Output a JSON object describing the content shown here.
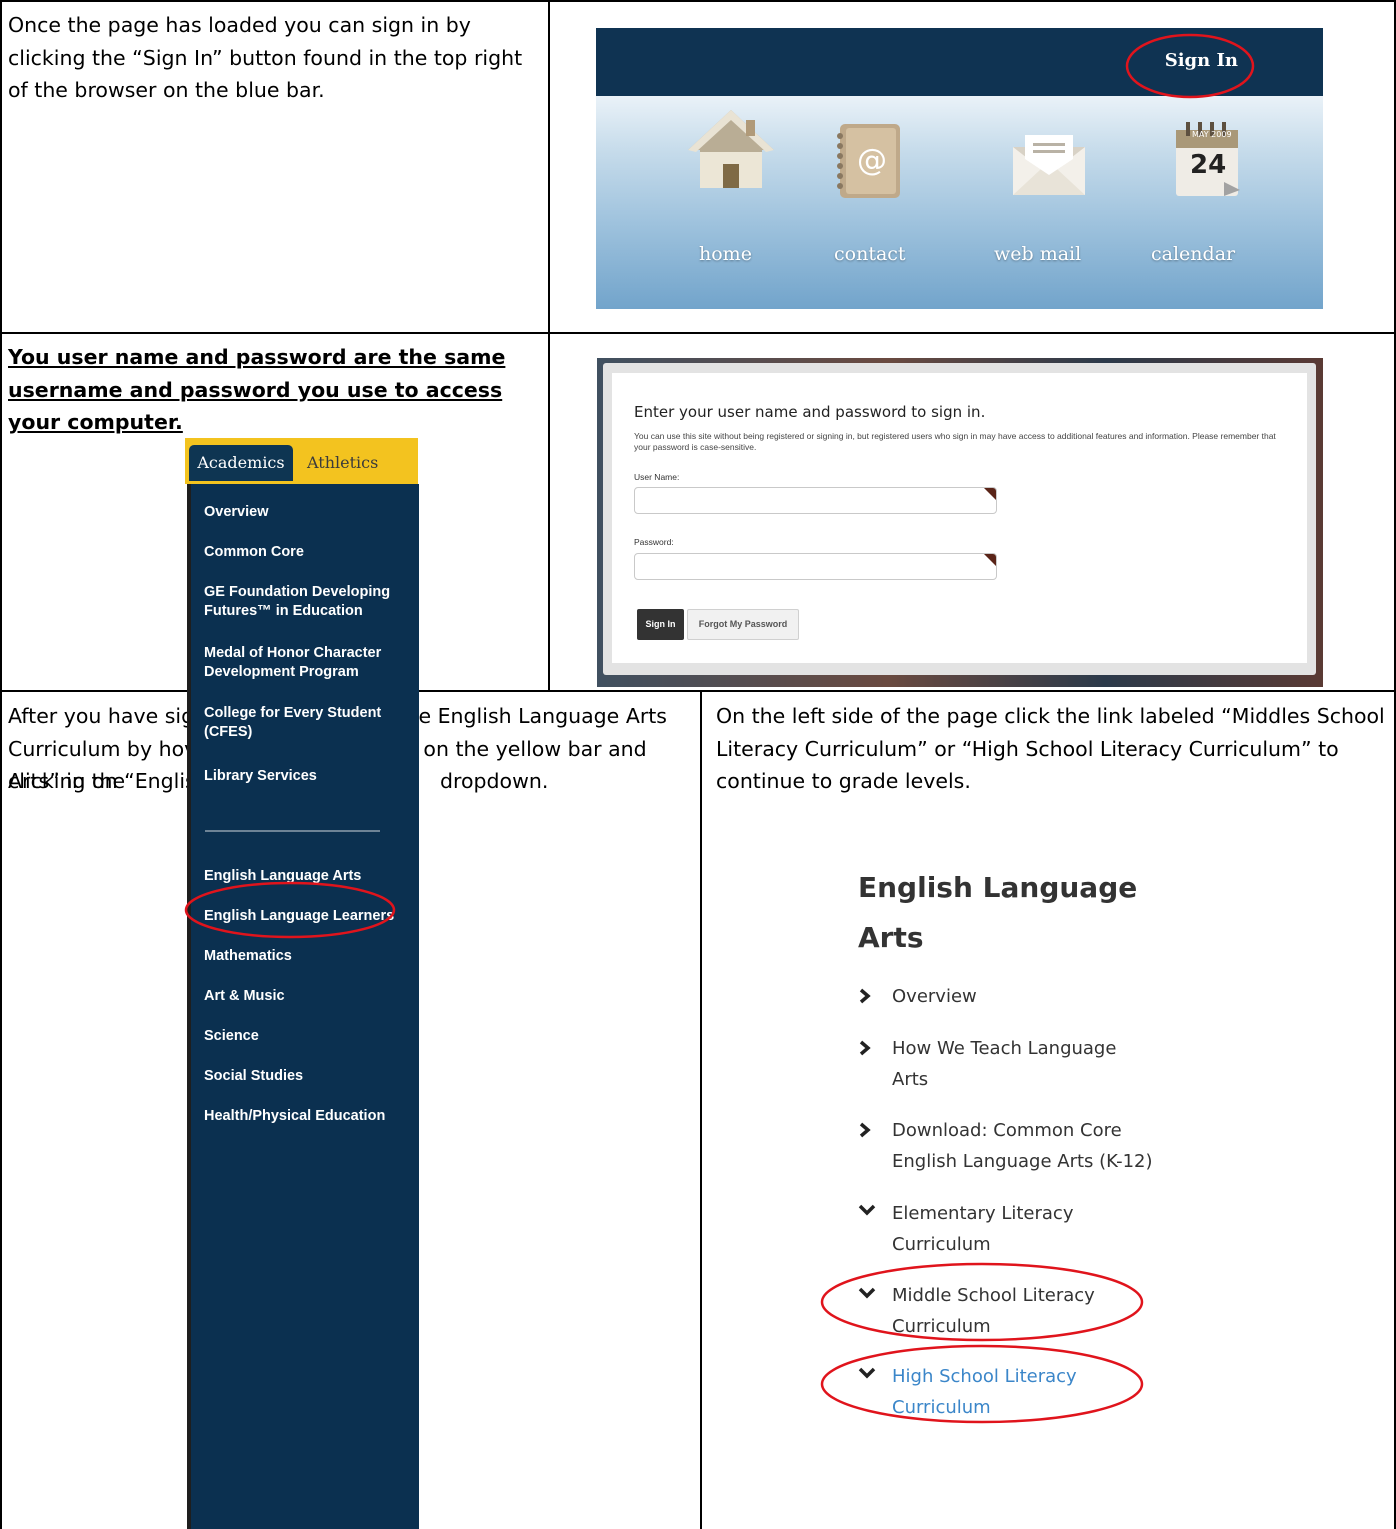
{
  "row1": {
    "instruction": "Once the page has loaded you can sign in by clicking the “Sign In” button found in the top right of the browser on the blue bar.",
    "screenshot": {
      "sign_in_label": "Sign In",
      "icons": [
        {
          "icon": "house-icon",
          "label": "home"
        },
        {
          "icon": "address-book-icon",
          "label": "contact"
        },
        {
          "icon": "envelope-icon",
          "label": "web mail"
        },
        {
          "icon": "calendar-icon",
          "label": "calendar",
          "calendar_month": "MAY 2009",
          "calendar_day": "24"
        }
      ],
      "accent_colors": {
        "bar": "#0f3352",
        "highlight_circle": "#e0141c"
      }
    }
  },
  "row2": {
    "instruction": "You user name and password are the same username and password you use to access your computer.",
    "screenshot": {
      "title": "Enter your user name and password to sign in.",
      "description": "You can use this site without being registered or signing in, but registered users who sign in may have access to additional features and information. Please remember that your password is case-sensitive.",
      "username_label": "User Name:",
      "password_label": "Password:",
      "sign_in_button": "Sign In",
      "forgot_button": "Forgot My Password"
    }
  },
  "row3": {
    "left": {
      "instruction_main": "After you have signed in you can find the English Language Arts Curriculum by hovering on “Academics” on the yellow bar and clicking on “English Language",
      "instruction_prefix": "Arts” in the",
      "instruction_suffix": "dropdown.",
      "tabs": {
        "academics": "Academics",
        "athletics": "Athletics"
      },
      "dropdown_items": [
        "Overview",
        "Common Core",
        "GE Foundation Developing Futures™ in Education",
        "Medal of Honor Character Development Program",
        "College for Every Student (CFES)",
        "Library Services",
        "English Language Arts",
        "English Language Learners",
        "Mathematics",
        "Art & Music",
        "Science",
        "Social Studies",
        "Health/Physical Education"
      ]
    },
    "right": {
      "instruction": "On the left side of the page click the link labeled “Middles School Literacy Curriculum” or “High School Literacy Curriculum” to continue to grade levels.",
      "heading_line1": "English Language",
      "heading_line2": "Arts",
      "nav_items": [
        {
          "line1": "Overview",
          "line2": "",
          "chevron": "chevron-right-icon"
        },
        {
          "line1": "How We Teach Language",
          "line2": "Arts",
          "chevron": "chevron-right-icon"
        },
        {
          "line1": "Download: Common Core",
          "line2": "English Language Arts (K-12)",
          "chevron": "chevron-right-icon"
        },
        {
          "line1": "Elementary Literacy",
          "line2": "Curriculum",
          "chevron": "chevron-down-icon"
        },
        {
          "line1": "Middle School Literacy",
          "line2": "Curriculum",
          "chevron": "chevron-down-icon"
        },
        {
          "line1": "High School Literacy",
          "line2": "Curriculum",
          "chevron": "chevron-down-icon",
          "link_color": "#3b86c9"
        }
      ]
    }
  }
}
